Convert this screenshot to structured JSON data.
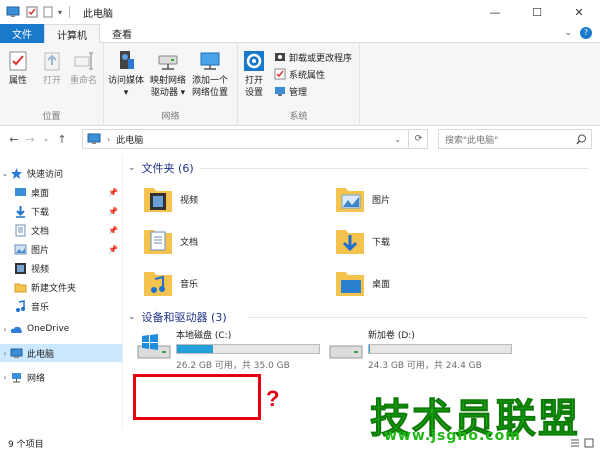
{
  "window": {
    "title": "此电脑",
    "minimize": "—",
    "maximize": "☐",
    "close": "✕"
  },
  "ribbon_tabs": [
    "文件",
    "计算机",
    "查看"
  ],
  "ribbon": {
    "location": {
      "label": "位置",
      "buttons": [
        "属性",
        "打开",
        "重命名"
      ]
    },
    "network": {
      "label": "网络",
      "buttons": [
        {
          "line1": "访问媒体",
          "line2": "▾"
        },
        {
          "line1": "映射网络",
          "line2": "驱动器 ▾"
        },
        {
          "line1": "添加一个",
          "line2": "网络位置"
        }
      ]
    },
    "system": {
      "label": "系统",
      "open_settings": {
        "line1": "打开",
        "line2": "设置"
      },
      "items": [
        "卸载或更改程序",
        "系统属性",
        "管理"
      ]
    }
  },
  "address": {
    "path": "此电脑",
    "search_placeholder": "搜索\"此电脑\""
  },
  "nav": {
    "quick_access": "快速访问",
    "items": [
      {
        "label": "桌面",
        "pinned": true
      },
      {
        "label": "下载",
        "pinned": true
      },
      {
        "label": "文档",
        "pinned": true
      },
      {
        "label": "图片",
        "pinned": true
      },
      {
        "label": "视频",
        "pinned": false
      },
      {
        "label": "新建文件夹",
        "pinned": false
      },
      {
        "label": "音乐",
        "pinned": false
      }
    ],
    "onedrive": "OneDrive",
    "this_pc": "此电脑",
    "network": "网络"
  },
  "folders": {
    "header": "文件夹 (6)",
    "items": [
      "视频",
      "图片",
      "文档",
      "下载",
      "音乐",
      "桌面"
    ]
  },
  "drives": {
    "header": "设备和驱动器 (3)",
    "items": [
      {
        "name": "本地磁盘 (C:)",
        "free": "26.2 GB 可用，共 35.0 GB",
        "used_fraction": 0.25
      },
      {
        "name": "新加卷 (D:)",
        "free": "24.3 GB 可用，共 24.4 GB",
        "used_fraction": 0.005
      }
    ]
  },
  "annotation": {
    "question_mark": "?"
  },
  "watermark": {
    "text": "技术员联盟",
    "url": "www.jsgho.com"
  },
  "status": {
    "count": "9 个项目"
  }
}
